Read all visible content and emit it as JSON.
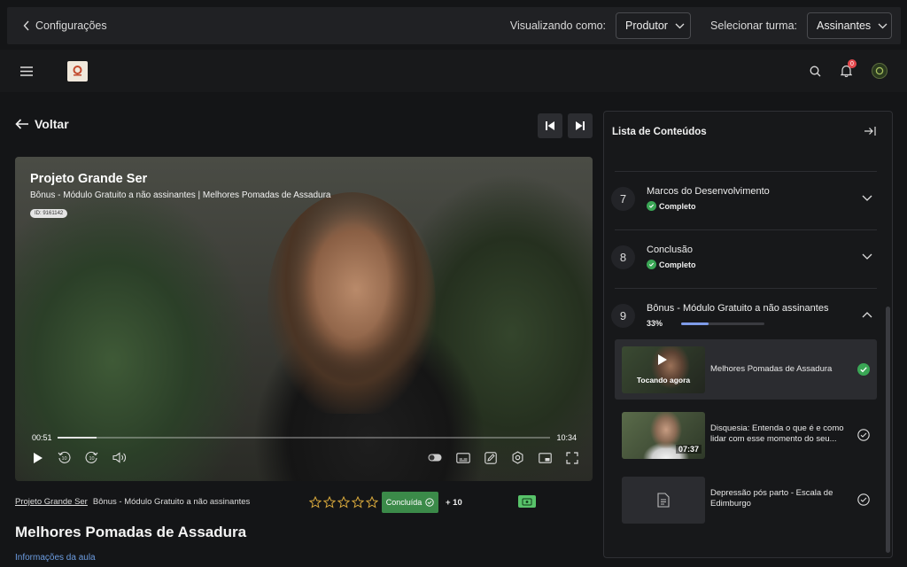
{
  "topbar": {
    "back_label": "Configurações",
    "viewing_label": "Visualizando como:",
    "viewing_value": "Produtor",
    "class_label": "Selecionar turma:",
    "class_value": "Assinantes"
  },
  "header": {
    "notification_count": "0"
  },
  "page": {
    "back_label": "Voltar"
  },
  "video": {
    "title": "Projeto Grande Ser",
    "subtitle": "Bônus - Módulo Gratuito a não assinantes | Melhores Pomadas de Assadura",
    "id_label": "ID: 9161142",
    "current_time": "00:51",
    "total_time": "10:34",
    "progress_fraction": 0.08
  },
  "lesson_meta": {
    "breadcrumb_course": "Projeto Grande Ser",
    "breadcrumb_module": "Bônus - Módulo Gratuito a não assinantes",
    "rating": 0,
    "complete_label": "Concluída",
    "points": "+ 10",
    "title": "Melhores Pomadas de Assadura",
    "info_link": "Informações da aula"
  },
  "panel": {
    "title": "Lista de Conteúdos",
    "modules": [
      {
        "number": "7",
        "name": "Marcos do Desenvolvimento",
        "status": "Completo"
      },
      {
        "number": "8",
        "name": "Conclusão",
        "status": "Completo"
      },
      {
        "number": "9",
        "name": "Bônus - Módulo Gratuito a não assinantes",
        "progress_label": "33%",
        "progress": 0.33
      }
    ],
    "lessons": [
      {
        "name": "Melhores Pomadas de Assadura",
        "overlay": "Tocando agora",
        "state": "done"
      },
      {
        "name": "Disquesia: Entenda o que é e como lidar com esse momento do seu...",
        "duration": "07:37",
        "state": "pending"
      },
      {
        "name": "Depressão pós parto - Escala de Edimburgo",
        "state": "pending"
      }
    ]
  },
  "colors": {
    "accent_green": "#3b8a49",
    "progress_blue": "#7e9be8",
    "badge_red": "#e5484d"
  }
}
